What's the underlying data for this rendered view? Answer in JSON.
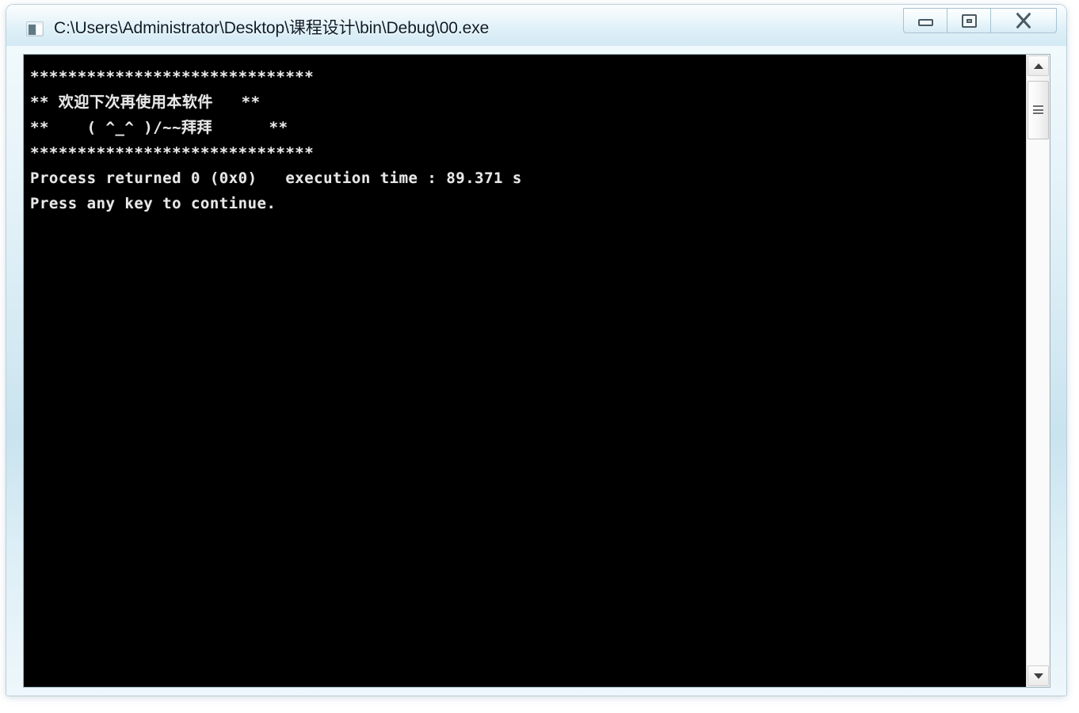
{
  "window": {
    "title": "C:\\Users\\Administrator\\Desktop\\课程设计\\bin\\Debug\\00.exe",
    "icon": "console-app-icon",
    "frame_color": "#d6ecf5",
    "client_background": "#000000",
    "text_color": "#e8e8e8"
  },
  "controls": {
    "minimize_label": "",
    "minimize_icon": "minimize-icon",
    "maximize_label": "",
    "maximize_icon": "restore-icon",
    "close_label": "",
    "close_icon": "close-icon"
  },
  "console": {
    "lines": [
      "******************************",
      "** 欢迎下次再使用本软件   **",
      "**    ( ^_^ )/~~拜拜      **",
      "******************************",
      "",
      "Process returned 0 (0x0)   execution time : 89.371 s",
      "Press any key to continue."
    ],
    "exit_code": "0",
    "exit_code_hex": "0x0",
    "execution_time": "89.371 s"
  },
  "scrollbar": {
    "up_arrow_icon": "scroll-up-arrow-icon",
    "down_arrow_icon": "scroll-down-arrow-icon",
    "thumb_icon": "scrollbar-thumb-grip"
  }
}
